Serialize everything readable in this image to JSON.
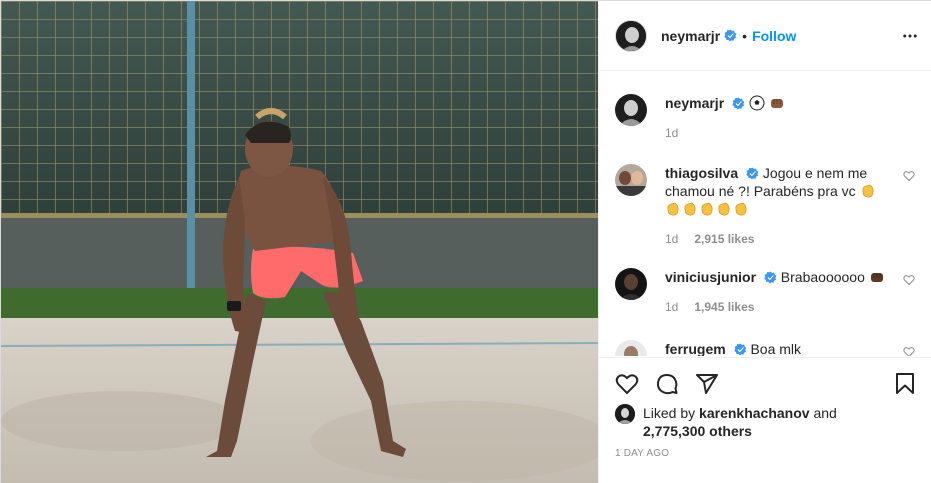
{
  "post": {
    "author": "neymarjr",
    "follow_label": "Follow",
    "separator": "•"
  },
  "caption": {
    "author": "neymarjr",
    "age": "1d"
  },
  "comments": [
    {
      "author": "thiagosilva",
      "text": "Jogou e nem me chamou né ?! Parabéns pra vc",
      "age": "1d",
      "likes": "2,915 likes"
    },
    {
      "author": "viniciusjunior",
      "text": "Brabaoooooo",
      "age": "1d",
      "likes": "1,945 likes"
    },
    {
      "author": "ferrugem",
      "text": "Boa mlk"
    }
  ],
  "likes": {
    "prefix": "Liked by",
    "user": "karenkhachanov",
    "conjunction": "and",
    "others": "2,775,300 others"
  },
  "timestamp": "1 DAY AGO",
  "colors": {
    "accent": "#0095f6",
    "verified": "#3897f0",
    "text": "#262626",
    "muted": "#8e8e8e",
    "border": "#efefef"
  },
  "icons": [
    "verified-badge-icon",
    "more-options-icon",
    "heart-icon",
    "comment-icon",
    "share-icon",
    "bookmark-icon",
    "soccer-ball-emoji",
    "fist-emoji",
    "clap-emoji"
  ]
}
